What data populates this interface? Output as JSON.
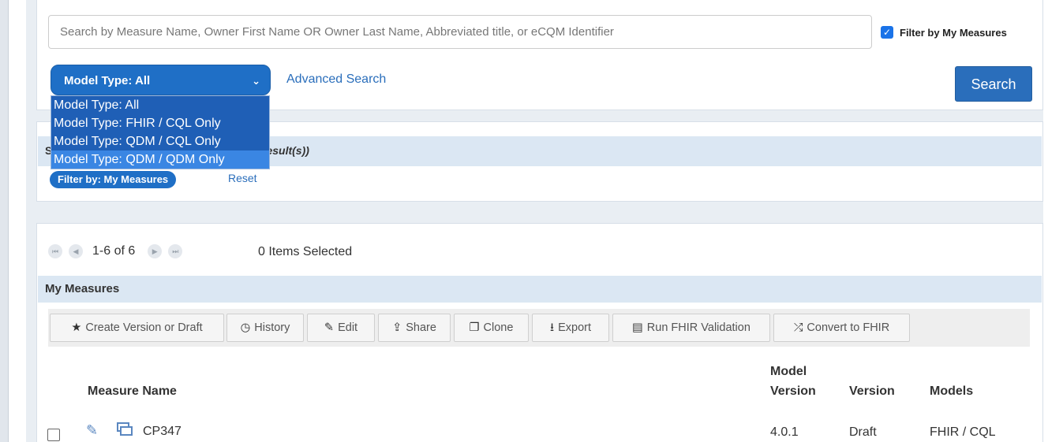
{
  "search": {
    "placeholder": "Search by Measure Name, Owner First Name OR Owner Last Name, Abbreviated title, or eCQM Identifier",
    "filter_checkbox_label": "Filter by My Measures",
    "filter_checked": true,
    "model_type_selected": "Model Type: All",
    "advanced_search_label": "Advanced Search",
    "search_button_label": "Search"
  },
  "model_type_dropdown": {
    "options": [
      "Model Type: All",
      "Model Type: FHIR / CQL Only",
      "Model Type: QDM / CQL Only",
      "Model Type: QDM / QDM Only"
    ],
    "highlighted_index": 3
  },
  "results": {
    "label_prefix": "S",
    "count_text": "result(s))",
    "filter_pill_label": "Filter by: My Measures",
    "reset_label": "Reset"
  },
  "pager": {
    "range_text": "1-6 of 6",
    "selected_text": "0 Items Selected"
  },
  "table": {
    "section_title": "My Measures",
    "toolbar": [
      {
        "icon": "star-icon",
        "glyph": "★",
        "label": "Create Version or Draft"
      },
      {
        "icon": "clock-icon",
        "glyph": "◷",
        "label": "History"
      },
      {
        "icon": "edit-icon",
        "glyph": "✎",
        "label": "Edit"
      },
      {
        "icon": "share-icon",
        "glyph": "⇪",
        "label": "Share"
      },
      {
        "icon": "clone-icon",
        "glyph": "❐",
        "label": "Clone"
      },
      {
        "icon": "export-icon",
        "glyph": "⭳",
        "label": "Export"
      },
      {
        "icon": "document-icon",
        "glyph": "▤",
        "label": "Run FHIR Validation"
      },
      {
        "icon": "shuffle-icon",
        "glyph": "⤮",
        "label": "Convert to FHIR"
      }
    ],
    "columns": {
      "measure_name": "Measure Name",
      "model_version_line1": "Model",
      "model_version_line2": "Version",
      "version": "Version",
      "models": "Models"
    },
    "rows": [
      {
        "measure_name": "CP347",
        "model_version": "4.0.1",
        "version": "Draft",
        "models": "FHIR / CQL"
      }
    ]
  },
  "colors": {
    "accent": "#1f6fc6",
    "link": "#2a6ebb",
    "section_bar": "#dbe7f3"
  }
}
